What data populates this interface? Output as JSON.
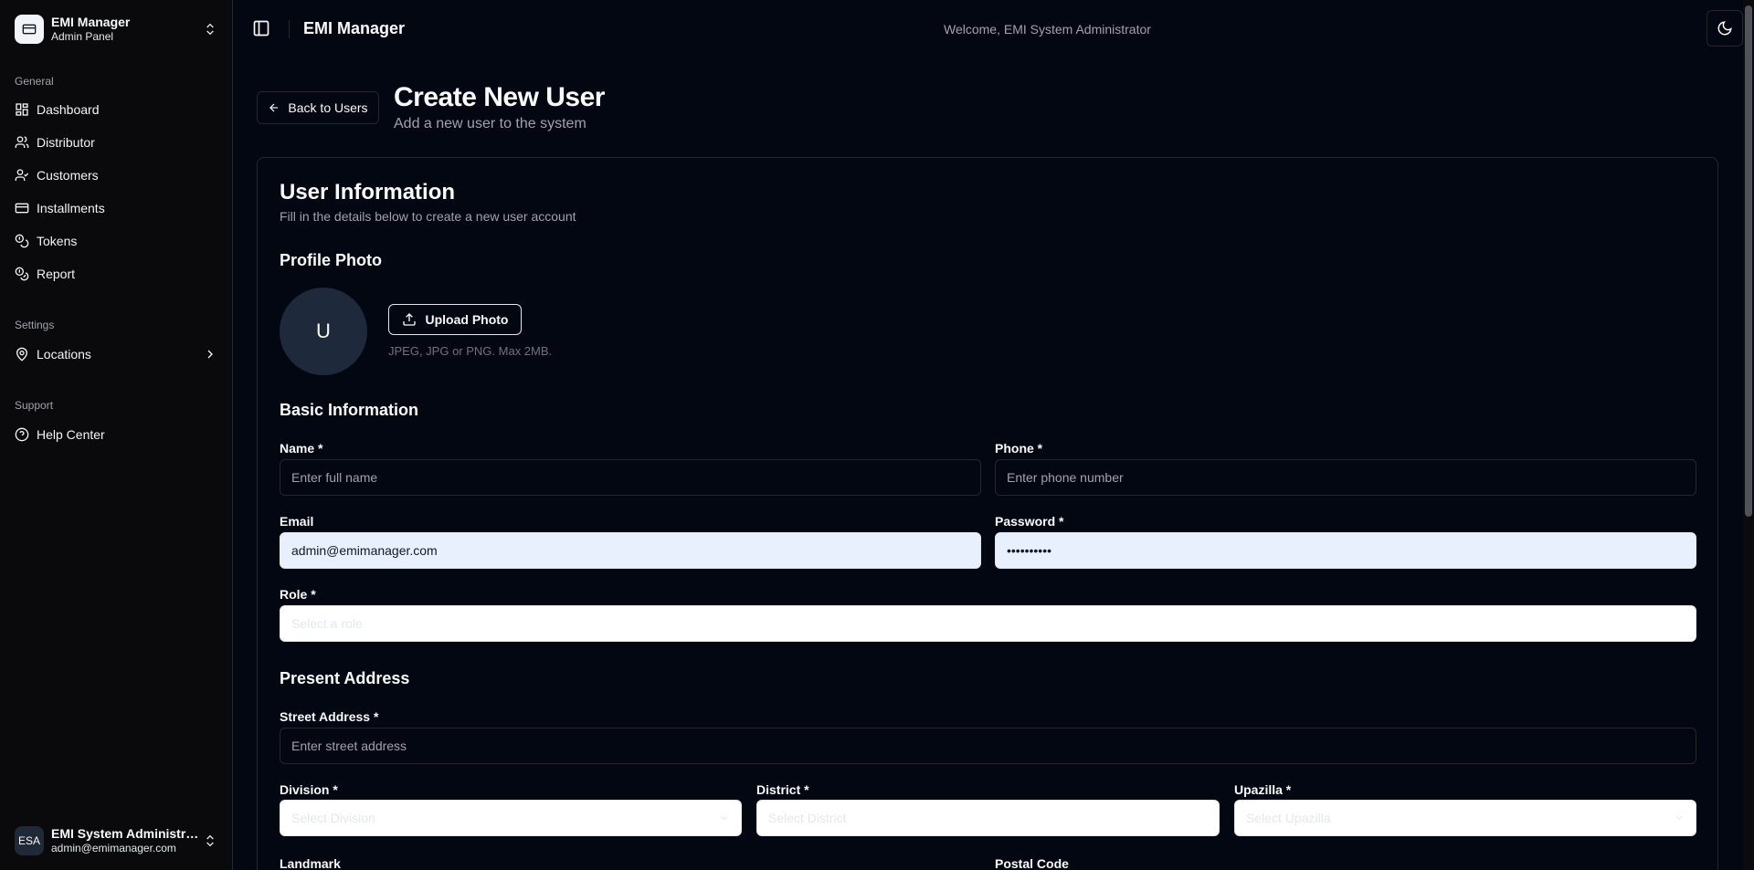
{
  "sidebar": {
    "brand": {
      "title": "EMI Manager",
      "subtitle": "Admin Panel"
    },
    "groups": {
      "general": "General",
      "settings": "Settings",
      "support": "Support"
    },
    "items": {
      "dashboard": "Dashboard",
      "distributor": "Distributor",
      "customers": "Customers",
      "installments": "Installments",
      "tokens": "Tokens",
      "report": "Report",
      "locations": "Locations",
      "help": "Help Center"
    },
    "user": {
      "initials": "ESA",
      "name": "EMI System Administra...",
      "email": "admin@emimanager.com"
    }
  },
  "header": {
    "title": "EMI Manager",
    "welcome": "Welcome, EMI System Administrator"
  },
  "page": {
    "back_label": "Back to Users",
    "title": "Create New User",
    "subtitle": "Add a new user to the system"
  },
  "card": {
    "title": "User Information",
    "subtitle": "Fill in the details below to create a new user account"
  },
  "profile": {
    "section_title": "Profile Photo",
    "avatar_initial": "U",
    "upload_label": "Upload Photo",
    "hint": "JPEG, JPG or PNG. Max 2MB."
  },
  "basic": {
    "section_title": "Basic Information",
    "name": {
      "label": "Name *",
      "placeholder": "Enter full name",
      "value": ""
    },
    "phone": {
      "label": "Phone *",
      "placeholder": "Enter phone number",
      "value": ""
    },
    "email": {
      "label": "Email",
      "placeholder": "",
      "value": "admin@emimanager.com"
    },
    "password": {
      "label": "Password *",
      "placeholder": "",
      "value": "••••••••••"
    },
    "role": {
      "label": "Role *",
      "placeholder": "Select a role"
    }
  },
  "address": {
    "section_title": "Present Address",
    "street": {
      "label": "Street Address *",
      "placeholder": "Enter street address"
    },
    "division": {
      "label": "Division *",
      "placeholder": "Select Division"
    },
    "district": {
      "label": "District *",
      "placeholder": "Select District"
    },
    "upazilla": {
      "label": "Upazilla *",
      "placeholder": "Select Upazilla"
    },
    "landmark": {
      "label": "Landmark"
    },
    "postal": {
      "label": "Postal Code"
    }
  },
  "icons": [
    "grid-icon",
    "users-icon",
    "user-check-icon",
    "card-icon",
    "tokens-icon",
    "report-icon",
    "map-pin-icon",
    "help-circle-icon",
    "panel-left-icon",
    "moon-icon",
    "arrow-left-icon",
    "upload-icon",
    "chevrons-up-down-icon",
    "chevron-right-icon"
  ]
}
